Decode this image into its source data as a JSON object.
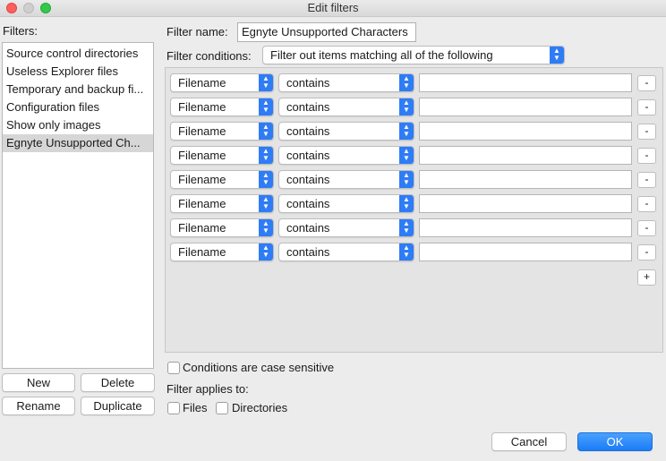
{
  "window": {
    "title": "Edit filters"
  },
  "sidebar": {
    "label": "Filters:",
    "items": [
      "Source control directories",
      "Useless Explorer files",
      "Temporary and backup fi...",
      "Configuration files",
      "Show only images",
      "Egnyte Unsupported Ch..."
    ],
    "selected_index": 5,
    "buttons": {
      "new": "New",
      "delete": "Delete",
      "rename": "Rename",
      "duplicate": "Duplicate"
    }
  },
  "main": {
    "filter_name_label": "Filter name:",
    "filter_name_value": "Egnyte Unsupported Characters",
    "filter_conditions_label": "Filter conditions:",
    "filter_conditions_value": "Filter out items matching all of the following",
    "conditions": [
      {
        "field": "Filename",
        "operator": "contains",
        "value": ""
      },
      {
        "field": "Filename",
        "operator": "contains",
        "value": ""
      },
      {
        "field": "Filename",
        "operator": "contains",
        "value": ""
      },
      {
        "field": "Filename",
        "operator": "contains",
        "value": ""
      },
      {
        "field": "Filename",
        "operator": "contains",
        "value": ""
      },
      {
        "field": "Filename",
        "operator": "contains",
        "value": ""
      },
      {
        "field": "Filename",
        "operator": "contains",
        "value": ""
      },
      {
        "field": "Filename",
        "operator": "contains",
        "value": ""
      }
    ],
    "remove_label": "-",
    "add_label": "+",
    "case_sensitive_label": "Conditions are case sensitive",
    "applies_to_label": "Filter applies to:",
    "files_label": "Files",
    "directories_label": "Directories"
  },
  "footer": {
    "cancel": "Cancel",
    "ok": "OK"
  },
  "colors": {
    "accent": "#1b7cf7",
    "selection": "#d6d6d6"
  }
}
